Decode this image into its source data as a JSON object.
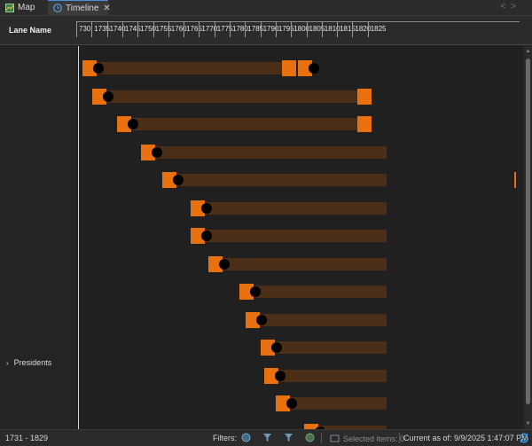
{
  "tabs": [
    {
      "label": "Map",
      "icon": "map-icon"
    },
    {
      "label": "Timeline",
      "icon": "timeline-icon",
      "active": true,
      "close": "✕"
    }
  ],
  "nav": {
    "prev": "<",
    "next": ">"
  },
  "header": {
    "lane_title": "Lane Name",
    "ticks": [
      "730",
      "1735",
      "1740",
      "1745",
      "1750",
      "1755",
      "1760",
      "1765",
      "1770",
      "1775",
      "1780",
      "1785",
      "1790",
      "1795",
      "1800",
      "1805",
      "1810",
      "1815",
      "1820",
      "1825"
    ]
  },
  "lanes": [
    {
      "label": "Presidents",
      "expanded": false
    }
  ],
  "events": [
    {
      "start": 1732,
      "end": 1799,
      "extra_marker": 1797
    },
    {
      "start": 1735,
      "end": 1826
    },
    {
      "start": 1743,
      "end": 1826
    },
    {
      "start": 1751,
      "end": 1831
    },
    {
      "start": 1758,
      "end": 1831
    },
    {
      "start": 1767,
      "end": 1831
    },
    {
      "start": 1767,
      "end": 1831
    },
    {
      "start": 1773,
      "end": 1831
    },
    {
      "start": 1783,
      "end": 1831
    },
    {
      "start": 1785,
      "end": 1831
    },
    {
      "start": 1790,
      "end": 1831
    },
    {
      "start": 1791,
      "end": 1831
    },
    {
      "start": 1795,
      "end": 1831
    },
    {
      "start": 1804,
      "end": 1831
    }
  ],
  "status": {
    "range": "1731 - 1829",
    "filters_label": "Filters:",
    "selected": "Selected items: 0",
    "current": "Current as of: 9/9/2025 1:47:07 PM"
  },
  "colors": {
    "accent": "#e8700e",
    "bar": "#4a2e18",
    "background": "#202020"
  }
}
